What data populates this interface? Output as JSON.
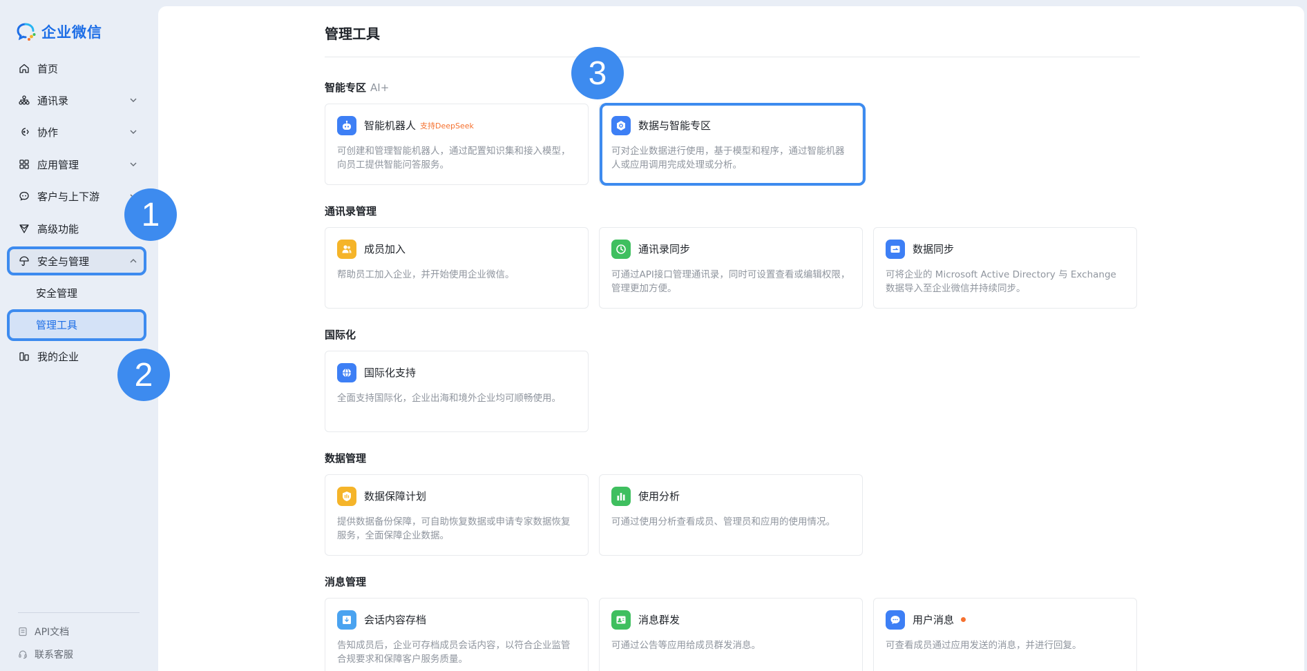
{
  "brand": {
    "name": "企业微信"
  },
  "sidebar": {
    "items": [
      {
        "label": "首页",
        "icon": "home-icon"
      },
      {
        "label": "通讯录",
        "icon": "org-chart-icon",
        "chevron": "down"
      },
      {
        "label": "协作",
        "icon": "collaborate-icon",
        "chevron": "down"
      },
      {
        "label": "应用管理",
        "icon": "apps-grid-icon",
        "chevron": "down"
      },
      {
        "label": "客户与上下游",
        "icon": "chat-bubble-icon",
        "chevron": "down"
      },
      {
        "label": "高级功能",
        "icon": "diamond-icon"
      },
      {
        "label": "安全与管理",
        "icon": "umbrella-icon",
        "chevron": "up",
        "expanded": true
      },
      {
        "label": "安全管理",
        "sub": true
      },
      {
        "label": "管理工具",
        "sub": true,
        "active": true
      },
      {
        "label": "我的企业",
        "icon": "buildings-icon"
      }
    ],
    "footer": [
      {
        "label": "API文档",
        "icon": "document-icon"
      },
      {
        "label": "联系客服",
        "icon": "headset-icon"
      }
    ]
  },
  "main": {
    "title": "管理工具",
    "sections": [
      {
        "title": "智能专区",
        "tag": "AI+",
        "cards": [
          {
            "title": "智能机器人",
            "badge": "支持DeepSeek",
            "desc": "可创建和管理智能机器人，通过配置知识集和接入模型，向员工提供智能问答服务。",
            "icon": "robot-icon",
            "color": "#3d7ff5"
          },
          {
            "title": "数据与智能专区",
            "desc": "可对企业数据进行使用，基于模型和程序，通过智能机器人或应用调用完成处理或分析。",
            "icon": "hexagon-chip-icon",
            "color": "#3d7ff5"
          }
        ]
      },
      {
        "title": "通讯录管理",
        "cards": [
          {
            "title": "成员加入",
            "desc": "帮助员工加入企业，并开始使用企业微信。",
            "icon": "member-join-icon",
            "color": "#f5b429"
          },
          {
            "title": "通讯录同步",
            "desc": "可通过API接口管理通讯录，同时可设置查看或编辑权限，管理更加方便。",
            "icon": "sync-icon",
            "color": "#3fbf5f"
          },
          {
            "title": "数据同步",
            "desc": "可将企业的 Microsoft Active Directory 与 Exchange 数据导入至企业微信并持续同步。",
            "icon": "folder-sync-icon",
            "color": "#3d7ff5"
          }
        ]
      },
      {
        "title": "国际化",
        "cards": [
          {
            "title": "国际化支持",
            "desc": "全面支持国际化，企业出海和境外企业均可顺畅使用。",
            "icon": "globe-icon",
            "color": "#3d7ff5"
          }
        ]
      },
      {
        "title": "数据管理",
        "cards": [
          {
            "title": "数据保障计划",
            "desc": "提供数据备份保障，可自助恢复数据或申请专家数据恢复服务，全面保障企业数据。",
            "icon": "shield-data-icon",
            "color": "#f5b429"
          },
          {
            "title": "使用分析",
            "desc": "可通过使用分析查看成员、管理员和应用的使用情况。",
            "icon": "bar-chart-icon",
            "color": "#3fbf5f"
          }
        ]
      },
      {
        "title": "消息管理",
        "cards": [
          {
            "title": "会话内容存档",
            "desc": "告知成员后，企业可存档成员会话内容，以符合企业监管合规要求和保障客户服务质量。",
            "icon": "archive-icon",
            "color": "#4aa3f0"
          },
          {
            "title": "消息群发",
            "desc": "可通过公告等应用给成员群发消息。",
            "icon": "broadcast-icon",
            "color": "#3fbf5f"
          },
          {
            "title": "用户消息",
            "desc": "可查看成员通过应用发送的消息，并进行回复。",
            "icon": "message-icon",
            "color": "#3d7ff5",
            "dot": true
          }
        ]
      }
    ]
  },
  "annotations": {
    "steps": [
      "1",
      "2",
      "3"
    ],
    "color": "#3d8bef"
  }
}
